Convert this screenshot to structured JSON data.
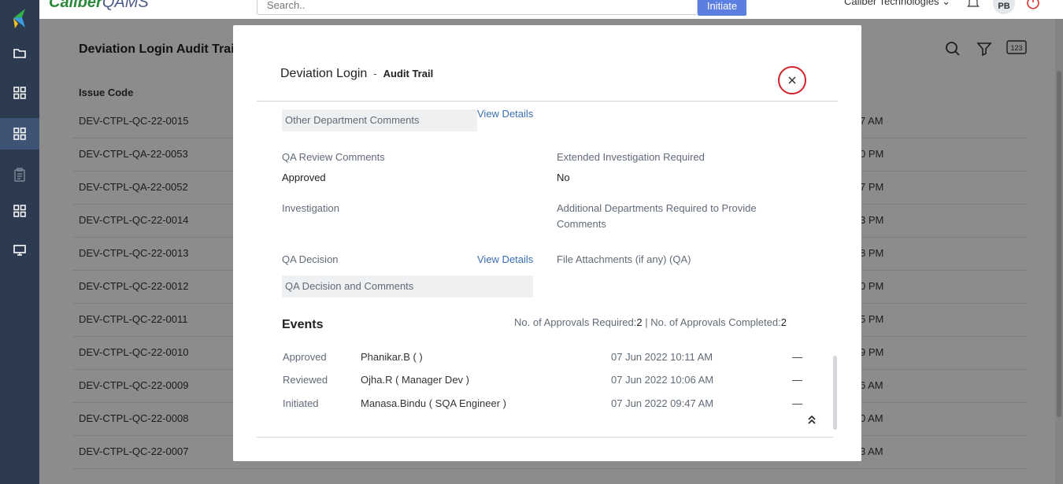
{
  "app": {
    "brand_main": "Caliber",
    "brand_sub": "QAMS",
    "org_name": "Caliber Technologies",
    "avatar": "PB"
  },
  "search": {
    "placeholder": "Search.."
  },
  "initiate_label": "Initiate",
  "sidebar": {
    "items": [
      {
        "icon": "folder-icon"
      },
      {
        "icon": "grid-icon"
      },
      {
        "icon": "grid-icon",
        "active": true
      },
      {
        "icon": "clipboard-icon"
      },
      {
        "icon": "grid-icon"
      },
      {
        "icon": "monitor-icon"
      }
    ]
  },
  "page": {
    "title": "Deviation Login Audit Trail",
    "column_header": "Issue Code",
    "rows": [
      {
        "code": "DEV-CTPL-QC-22-0015",
        "time": "7 AM"
      },
      {
        "code": "DEV-CTPL-QA-22-0053",
        "time": "0 PM"
      },
      {
        "code": "DEV-CTPL-QA-22-0052",
        "time": "7 PM"
      },
      {
        "code": "DEV-CTPL-QC-22-0014",
        "time": "3 PM"
      },
      {
        "code": "DEV-CTPL-QC-22-0013",
        "time": "8 PM"
      },
      {
        "code": "DEV-CTPL-QC-22-0012",
        "time": "0 PM"
      },
      {
        "code": "DEV-CTPL-QC-22-0011",
        "time": "5 PM"
      },
      {
        "code": "DEV-CTPL-QC-22-0010",
        "time": "9 PM"
      },
      {
        "code": "DEV-CTPL-QC-22-0009",
        "time": "6 AM"
      },
      {
        "code": "DEV-CTPL-QC-22-0008",
        "time": "0 AM"
      },
      {
        "code": "DEV-CTPL-QC-22-0007",
        "time": "3 AM"
      }
    ]
  },
  "modal": {
    "title": "Deviation Login",
    "separator": "-",
    "subtitle": "Audit Trail",
    "other_dept_comments": "Other Department Comments",
    "view_details": "View Details",
    "qa_review_label": "QA Review Comments",
    "qa_review_value": "Approved",
    "extended_investigation_label": "Extended Investigation Required",
    "extended_investigation_value": "No",
    "investigation_label": "Investigation",
    "additional_depts_label_line1": "Additional Departments Required to Provide",
    "additional_depts_label_line2": "Comments",
    "qa_decision_label": "QA Decision",
    "file_attachments_label": "File Attachments (if any) (QA)",
    "qa_decision_box": "QA Decision and Comments",
    "events_title": "Events",
    "approvals_required_label": "No. of Approvals Required:",
    "approvals_required_value": "2",
    "approvals_sep": " | ",
    "approvals_completed_label": "No. of Approvals Completed:",
    "approvals_completed_value": "2",
    "events": [
      {
        "action": "Approved",
        "user": "Phanikar.B ( )",
        "time": "07 Jun 2022 10:11 AM",
        "dash": "—"
      },
      {
        "action": "Reviewed",
        "user": "Ojha.R ( Manager Dev )",
        "time": "07 Jun 2022 10:06 AM",
        "dash": "—"
      },
      {
        "action": "Initiated",
        "user": "Manasa.Bindu ( SQA Engineer )",
        "time": "07 Jun 2022 09:47 AM",
        "dash": "—"
      }
    ]
  },
  "colors": {
    "sidebar": "#2c3b4f",
    "sidebar_active": "#3f5475",
    "brand_green": "#2a8a3a",
    "initiate_blue": "#5b7fe0",
    "link": "#3a6db3",
    "close_red": "#d0242b"
  }
}
